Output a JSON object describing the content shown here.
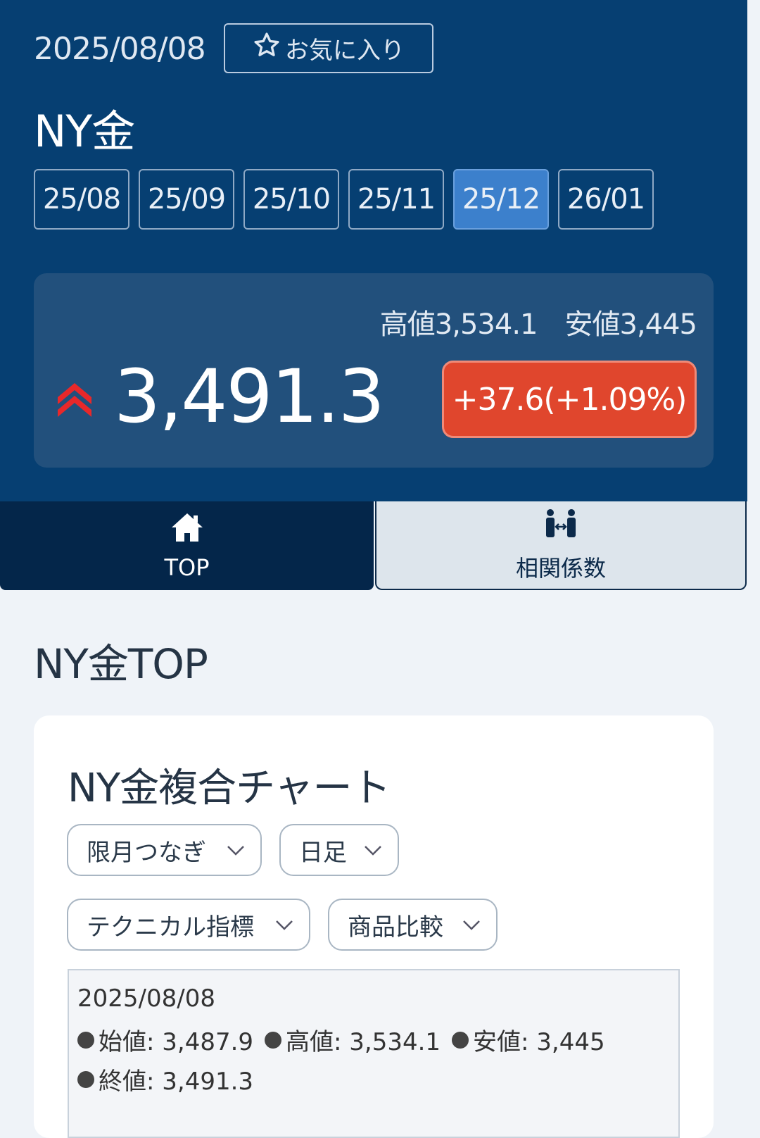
{
  "header": {
    "date": "2025/08/08",
    "favorite_label": "お気に入り",
    "title": "NY金"
  },
  "months": [
    {
      "label": "25/08",
      "active": false
    },
    {
      "label": "25/09",
      "active": false
    },
    {
      "label": "25/10",
      "active": false
    },
    {
      "label": "25/11",
      "active": false
    },
    {
      "label": "25/12",
      "active": true
    },
    {
      "label": "26/01",
      "active": false
    }
  ],
  "quote": {
    "high_low": "高値3,534.1　安値3,445",
    "price": "3,491.3",
    "change": "+37.6(+1.09%)",
    "direction": "up",
    "up_color": "#e8282a",
    "change_color": "#e0462d"
  },
  "tabs": {
    "top": {
      "label": "TOP",
      "icon": "home-icon"
    },
    "correlation": {
      "label": "相関係数",
      "icon": "correlation-icon"
    }
  },
  "section_title": "NY金TOP",
  "chart_card": {
    "title": "NY金複合チャート",
    "selects": {
      "contract": "限月つなぎ",
      "period": "日足",
      "indicator": "テクニカル指標",
      "compare": "商品比較"
    },
    "info": {
      "date": "2025/08/08",
      "open": "始値: 3,487.9",
      "high": "高値: 3,534.1",
      "low": "安値: 3,445",
      "close": "終値: 3,491.3"
    }
  },
  "colors": {
    "header_bg": "#063f72",
    "active_month": "#3c80cc",
    "tab_active_bg": "#04264a"
  }
}
